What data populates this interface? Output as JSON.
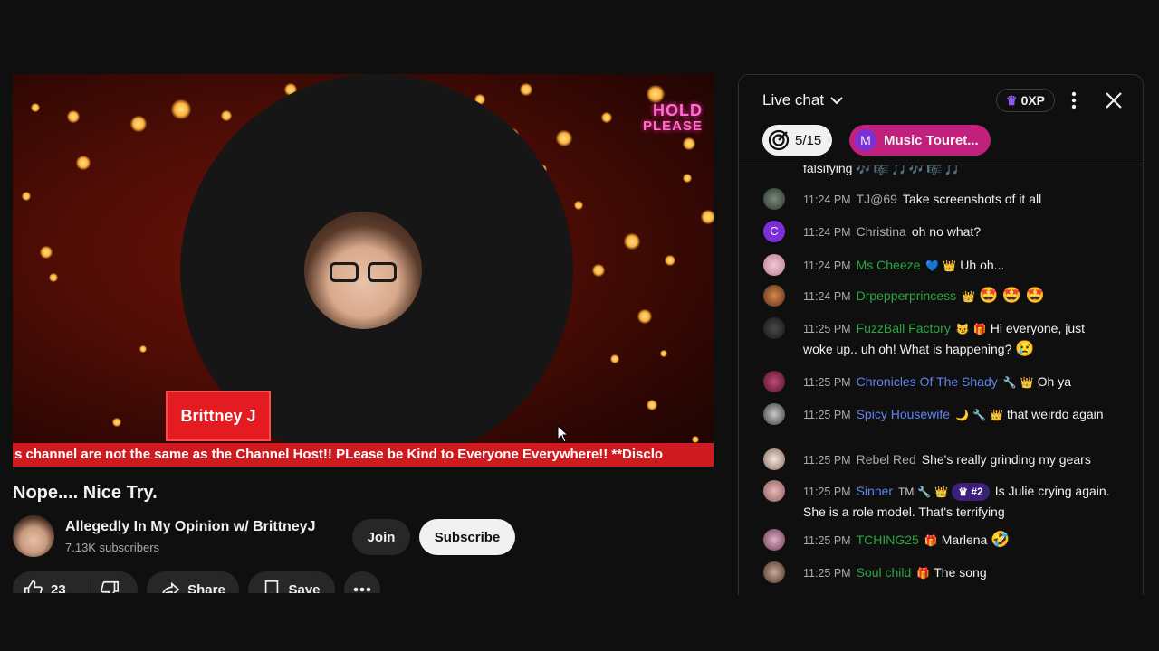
{
  "video": {
    "overlay_hold_line1": "HOLD",
    "overlay_hold_line2": "PLEASE",
    "name_tag": "Brittney J",
    "ticker": "s channel are not the same as the Channel Host!! PLease be Kind to Everyone Everywhere!! **Disclo"
  },
  "meta": {
    "title": "Nope.... Nice Try.",
    "channel_name": "Allegedly In My Opinion w/ BrittneyJ",
    "subscribers": "7.13K subscribers",
    "join_label": "Join",
    "subscribe_label": "Subscribe",
    "like_count": "23",
    "share_label": "Share",
    "save_label": "Save"
  },
  "chat": {
    "header_label": "Live chat",
    "xp_label": "0XP",
    "goal_progress": "5/15",
    "pinned_initial": "M",
    "pinned_label": "Music Touret...",
    "partial_top": "falsifying",
    "messages": [
      {
        "time": "11:24 PM",
        "author": "TJ@69",
        "text": "Take screenshots of it all"
      },
      {
        "time": "11:24 PM",
        "author": "Christina",
        "text": "oh no what?"
      },
      {
        "time": "11:24 PM",
        "author": "Ms Cheeze",
        "text": "Uh oh..."
      },
      {
        "time": "11:24 PM",
        "author": "Drpepperprincess",
        "text": ""
      },
      {
        "time": "11:25 PM",
        "author": "FuzzBall Factory",
        "text": "Hi everyone, just woke up.. uh oh! What is happening?"
      },
      {
        "time": "11:25 PM",
        "author": "Chronicles Of The Shady",
        "text": "Oh ya"
      },
      {
        "time": "11:25 PM",
        "author": "Spicy Housewife",
        "text": "that weirdo again"
      },
      {
        "time": "11:25 PM",
        "author": "Rebel Red",
        "text": "She's really grinding my gears"
      },
      {
        "time": "11:25 PM",
        "author": "Sinner",
        "rank": "#2",
        "text": "Is Julie crying again. She is a role model. That's terrifying"
      },
      {
        "time": "11:25 PM",
        "author": "TCHING25",
        "text": "Marlena"
      },
      {
        "time": "11:25 PM",
        "author": "Soul child",
        "text": "The song"
      }
    ],
    "christina_initial": "C",
    "tm_badge": "TM"
  }
}
